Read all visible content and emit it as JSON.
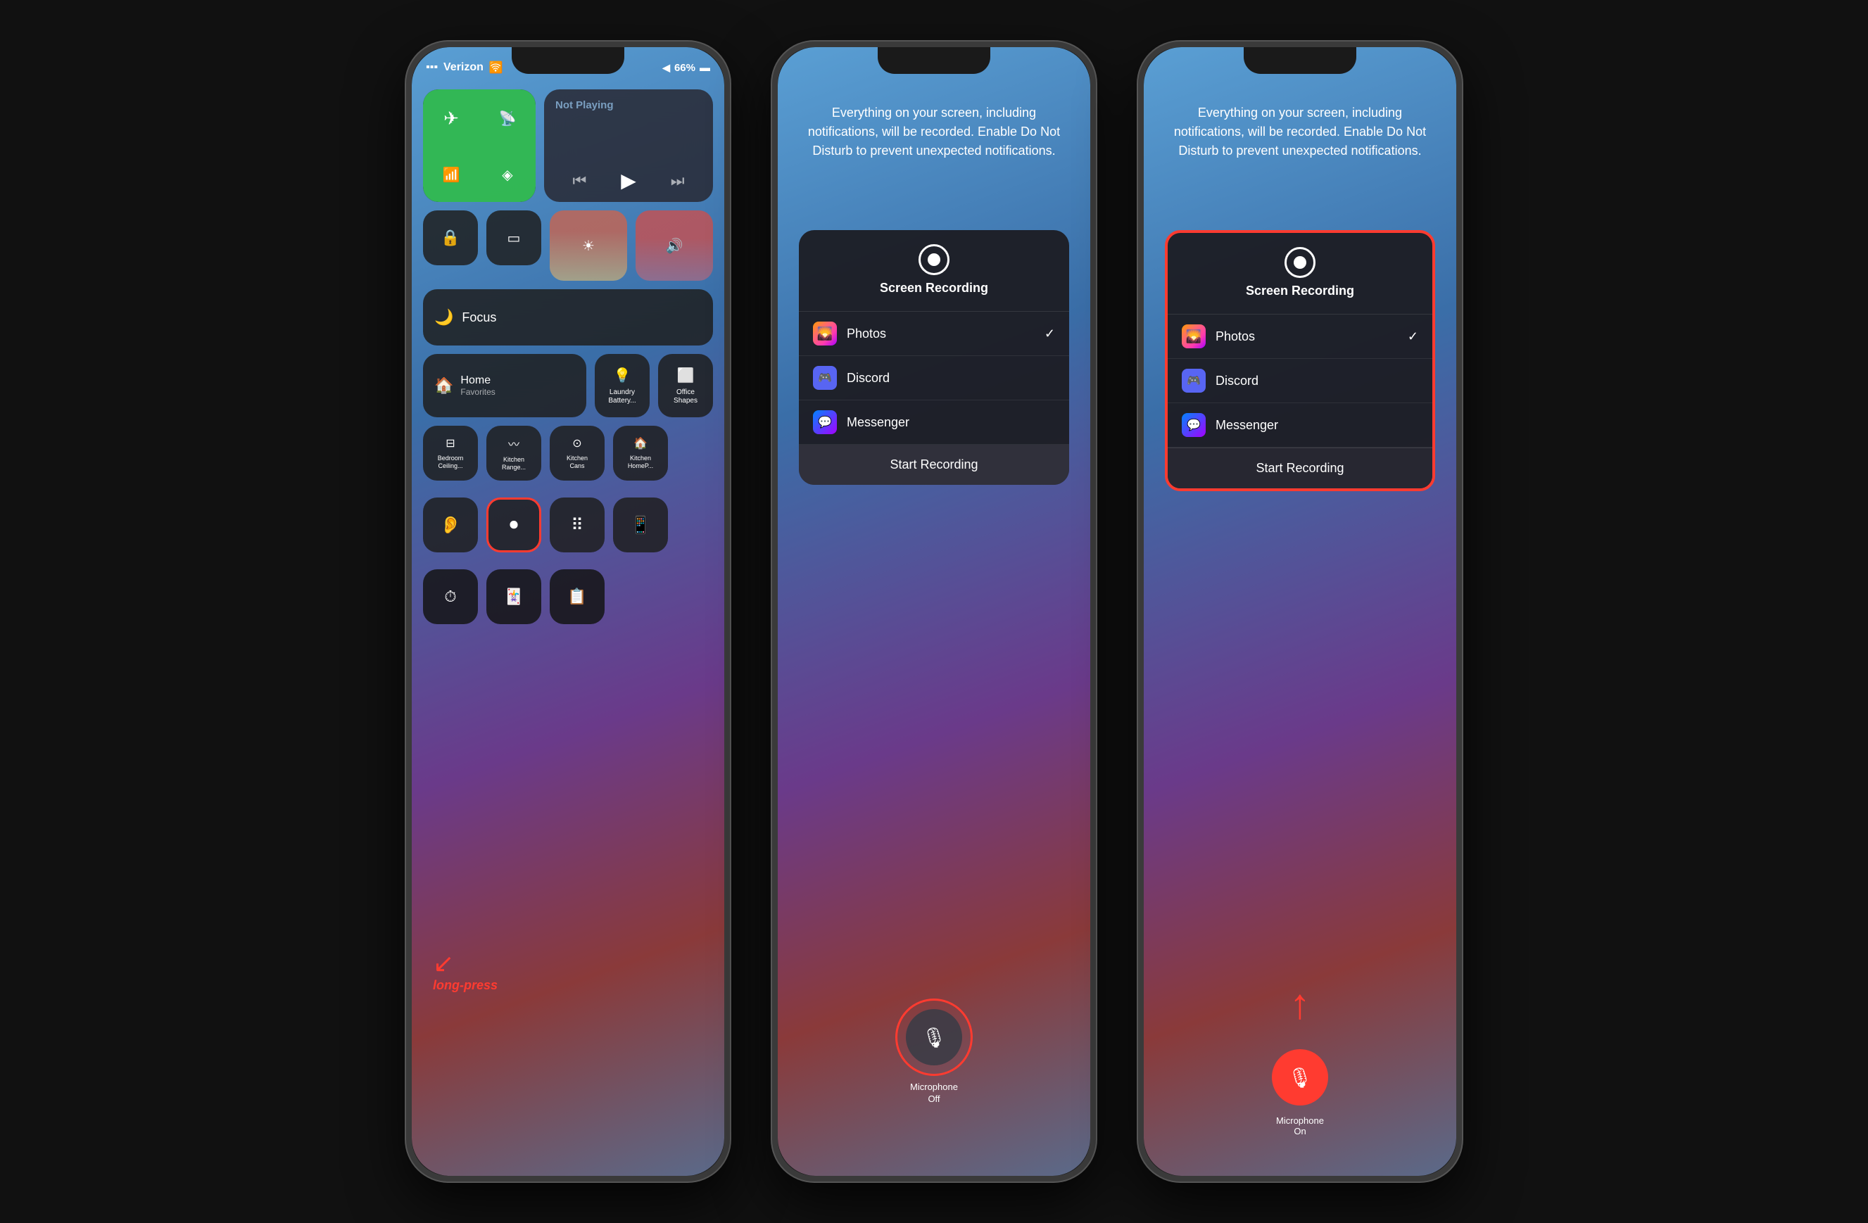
{
  "phone1": {
    "status": {
      "carrier": "Verizon",
      "signal_icon": "📶",
      "wifi_icon": "🛜",
      "location_icon": "◀",
      "battery": "66%",
      "battery_icon": "🔋"
    },
    "connectivity": {
      "airplane": "✈",
      "cellular": "📡",
      "wifi": "wifi",
      "bluetooth": "bluetooth"
    },
    "now_playing": {
      "title": "Not Playing",
      "prev": "⏮",
      "play": "▶",
      "next": "⏭"
    },
    "controls": {
      "screen_mirror": "mirror",
      "focus_label": "Focus",
      "home_label": "Home",
      "home_sub": "Favorites"
    },
    "tiles": [
      {
        "icon": "🏠",
        "label": "Home\nFavorites"
      },
      {
        "icon": "💡",
        "label": "Laundry\nBattery..."
      },
      {
        "icon": "⬜",
        "label": "Office\nShapes"
      }
    ],
    "tiles2": [
      {
        "icon": "💡",
        "label": "Bedroom\nCeiling..."
      },
      {
        "icon": "〰️",
        "label": "Kitchen\nRange..."
      },
      {
        "icon": "💡",
        "label": "Kitchen\nCans"
      },
      {
        "icon": "🏠",
        "label": "Kitchen\nHomeP..."
      }
    ],
    "bottom_buttons": [
      {
        "icon": "👂",
        "label": ""
      },
      {
        "icon": "⏺",
        "label": "",
        "highlighted": true
      },
      {
        "icon": "⠿",
        "label": ""
      },
      {
        "icon": "📱",
        "label": ""
      },
      {
        "icon": "⏱",
        "label": ""
      },
      {
        "icon": "🃏",
        "label": ""
      },
      {
        "icon": "📋",
        "label": ""
      }
    ],
    "annotation": "long-press"
  },
  "phone2": {
    "notice": "Everything on your screen, including notifications, will be recorded. Enable Do Not Disturb to prevent unexpected notifications.",
    "panel": {
      "title": "Screen Recording",
      "apps": [
        {
          "name": "Photos",
          "checked": true
        },
        {
          "name": "Discord",
          "checked": false
        },
        {
          "name": "Messenger",
          "checked": false
        }
      ],
      "start_button": "Start Recording"
    },
    "mic": {
      "label_line1": "Microphone",
      "label_line2": "Off"
    }
  },
  "phone3": {
    "notice": "Everything on your screen, including notifications, will be recorded. Enable Do Not Disturb to prevent unexpected notifications.",
    "panel": {
      "title": "Screen Recording",
      "apps": [
        {
          "name": "Photos",
          "checked": true
        },
        {
          "name": "Discord",
          "checked": false
        },
        {
          "name": "Messenger",
          "checked": false
        }
      ],
      "start_button": "Start Recording"
    },
    "mic": {
      "label_line1": "Microphone",
      "label_line2": "On"
    }
  }
}
